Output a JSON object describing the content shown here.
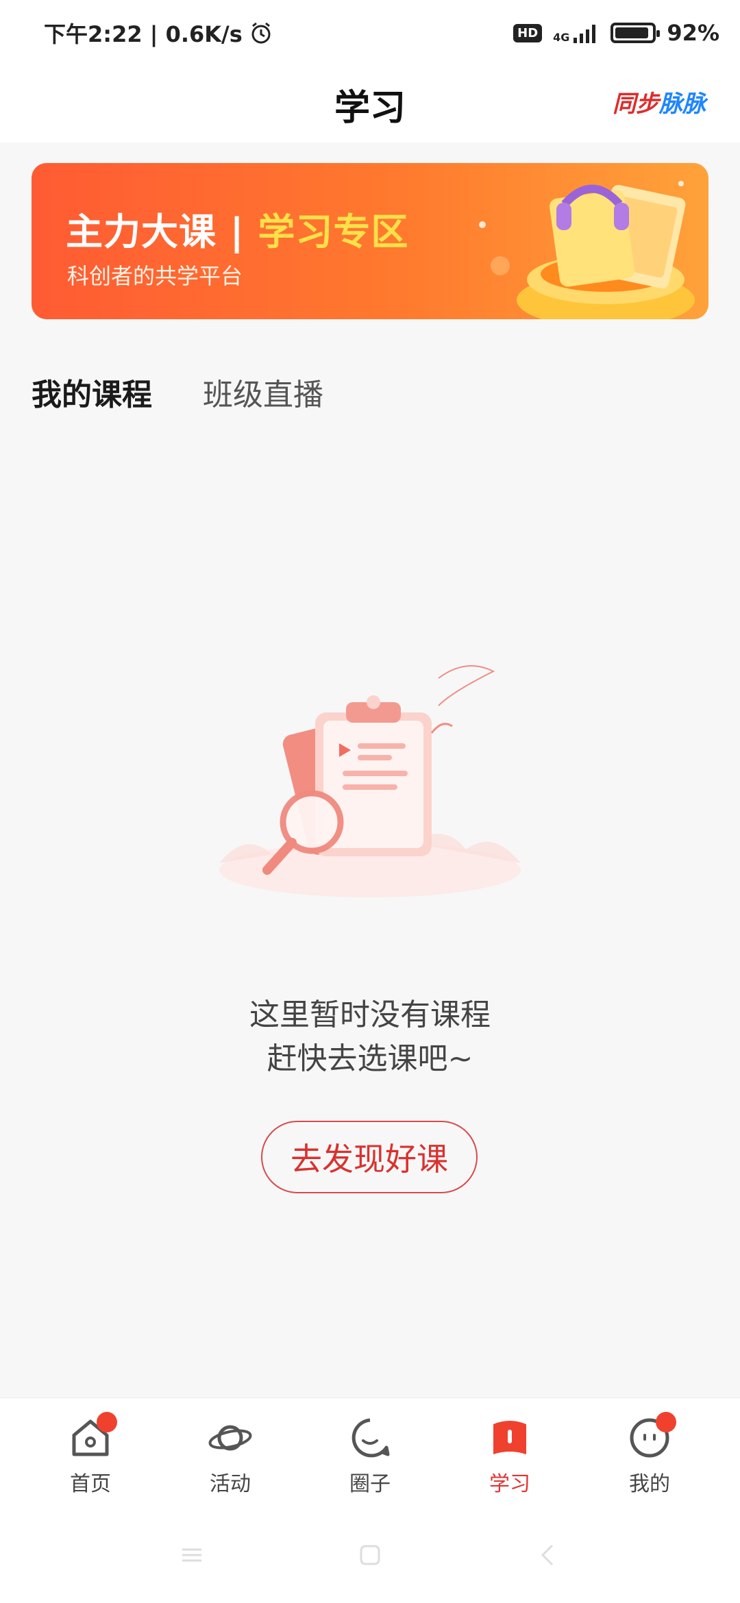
{
  "status": {
    "time_speed": "下午2:22 | 0.6K/s",
    "hd": "HD",
    "network": "4G",
    "battery": "92%",
    "battery_level": 0.92
  },
  "header": {
    "title": "学习",
    "logo_a": "同步",
    "logo_b": "脉脉"
  },
  "banner": {
    "title_main": "主力大课 | ",
    "title_highlight": "学习专区",
    "subtitle": "科创者的共学平台"
  },
  "tabs": [
    {
      "label": "我的课程",
      "active": true
    },
    {
      "label": "班级直播",
      "active": false
    }
  ],
  "empty_state": {
    "line1": "这里暂时没有课程",
    "line2": "赶快去选课吧~",
    "button_label": "去发现好课"
  },
  "bottom_nav": [
    {
      "label": "首页",
      "icon": "home-icon",
      "badge": true
    },
    {
      "label": "活动",
      "icon": "planet-icon",
      "badge": false
    },
    {
      "label": "圈子",
      "icon": "chat-circle-icon",
      "badge": false
    },
    {
      "label": "学习",
      "icon": "study-icon",
      "badge": false,
      "active": true
    },
    {
      "label": "我的",
      "icon": "profile-icon",
      "badge": true
    }
  ],
  "colors": {
    "accent": "#e03332",
    "banner_start": "#ff5b33",
    "banner_end": "#ffa23a",
    "highlight": "#ffe14a",
    "logo_blue": "#1f86ff"
  }
}
